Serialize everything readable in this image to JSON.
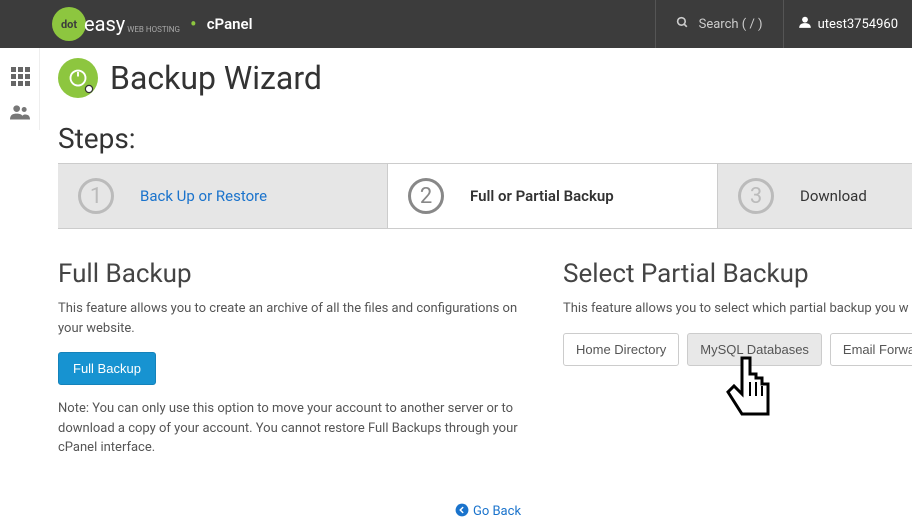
{
  "topbar": {
    "brand_prefix": "dot",
    "brand_suffix": "easy",
    "brand_sub": "WEB HOSTING",
    "cpanel": "cPanel",
    "search_placeholder": "Search ( / )",
    "username": "utest3754960"
  },
  "page": {
    "title": "Backup Wizard",
    "steps_heading": "Steps:",
    "steps": [
      {
        "num": "1",
        "label": "Back Up or Restore"
      },
      {
        "num": "2",
        "label": "Full or Partial Backup"
      },
      {
        "num": "3",
        "label": "Download"
      }
    ]
  },
  "full_backup": {
    "heading": "Full Backup",
    "desc": "This feature allows you to create an archive of all the files and configurations on your website.",
    "button": "Full Backup",
    "note": "Note: You can only use this option to move your account to another server or to download a copy of your account. You cannot restore Full Backups through your cPanel interface."
  },
  "partial": {
    "heading": "Select Partial Backup",
    "desc": "This feature allows you to select which partial backup you w",
    "buttons": {
      "home": "Home Directory",
      "mysql": "MySQL Databases",
      "email": "Email Forward"
    }
  },
  "goback": "Go Back"
}
